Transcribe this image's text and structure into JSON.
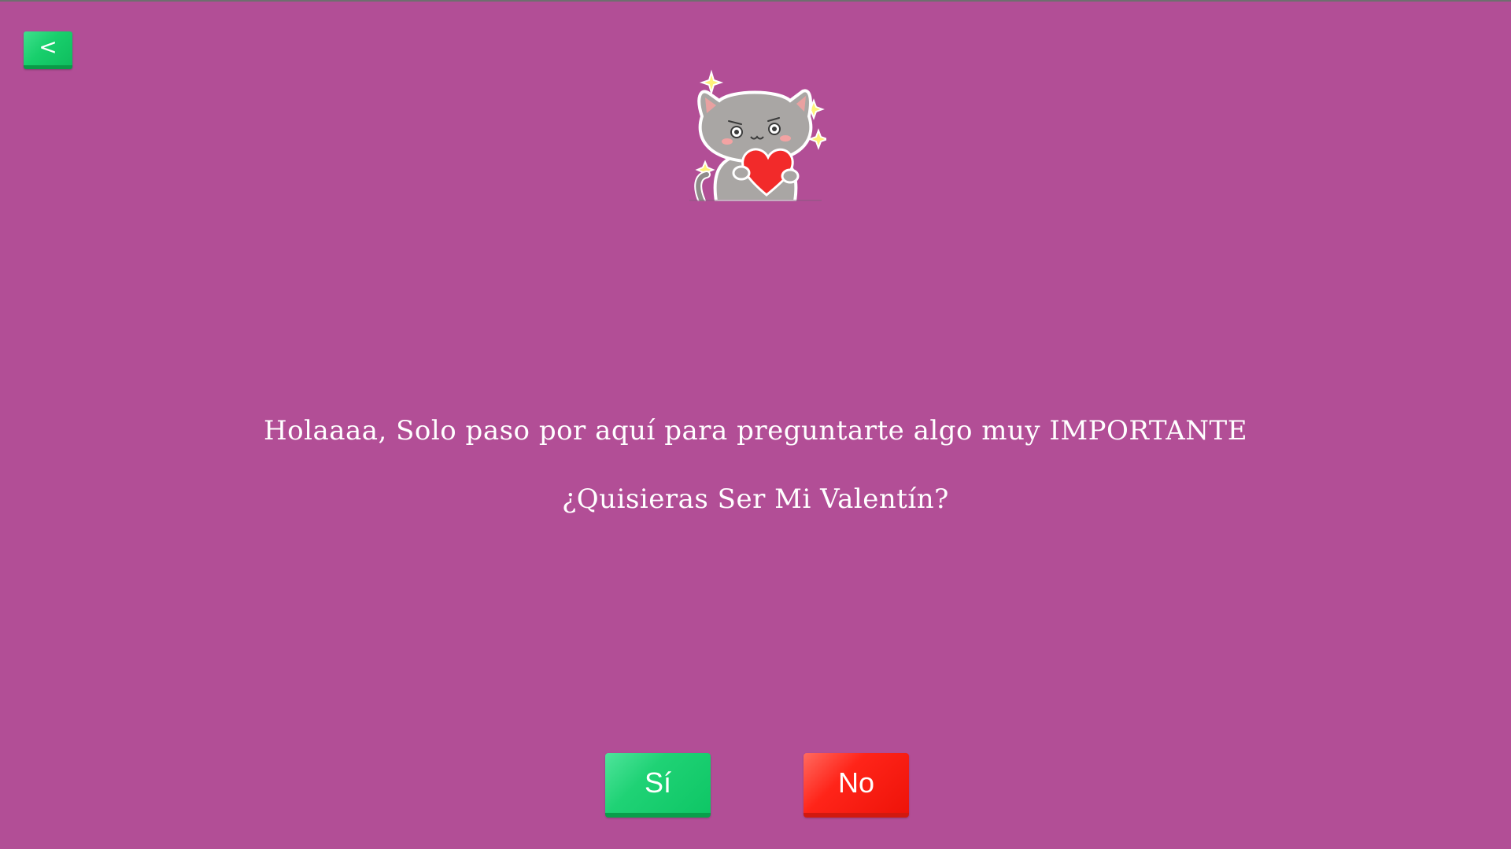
{
  "nav": {
    "back_label": "<"
  },
  "sticker": {
    "icon": "cat-holding-heart-icon"
  },
  "content": {
    "message": "Holaaaa, Solo paso por aquí para preguntarte algo muy IMPORTANTE",
    "question": "¿Quisieras Ser Mi Valentín?"
  },
  "actions": {
    "yes_label": "Sí",
    "no_label": "No"
  },
  "colors": {
    "background": "#b24e96",
    "yes": "#1fd275",
    "no": "#ff2419"
  }
}
